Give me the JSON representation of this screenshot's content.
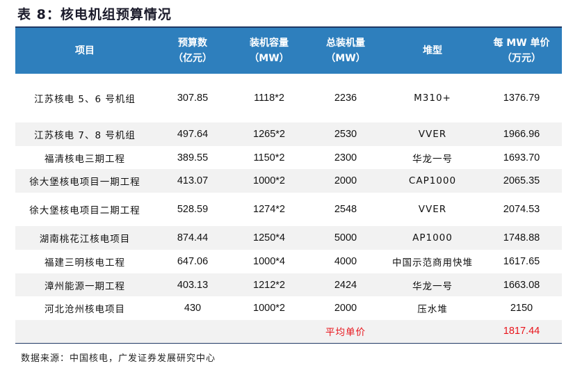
{
  "title": "表 8：核电机组预算情况",
  "header": {
    "project": "项目",
    "budget": [
      "预算数",
      "（亿元）"
    ],
    "capacity": [
      "装机容量",
      "（MW）"
    ],
    "total_capacity": [
      "总装机量",
      "（MW）"
    ],
    "reactor": "堆型",
    "unit_price": [
      "每 MW 单价",
      "（万元）"
    ]
  },
  "rows": [
    {
      "project": "江苏核电 5、6 号机组",
      "budget": "307.85",
      "capacity": "1118*2",
      "total": "2236",
      "reactor": "M310+",
      "price": "1376.79"
    },
    {
      "project": "江苏核电 7、8 号机组",
      "budget": "497.64",
      "capacity": "1265*2",
      "total": "2530",
      "reactor": "VVER",
      "price": "1966.96"
    },
    {
      "project": "福清核电三期工程",
      "budget": "389.55",
      "capacity": "1150*2",
      "total": "2300",
      "reactor": "华龙一号",
      "price": "1693.70"
    },
    {
      "project": "徐大堡核电项目一期工程",
      "budget": "413.07",
      "capacity": "1000*2",
      "total": "2000",
      "reactor": "CAP1000",
      "price": "2065.35"
    },
    {
      "project": "徐大堡核电项目二期工程",
      "budget": "528.59",
      "capacity": "1274*2",
      "total": "2548",
      "reactor": "VVER",
      "price": "2074.53"
    },
    {
      "project": "湖南桃花江核电项目",
      "budget": "874.44",
      "capacity": "1250*4",
      "total": "5000",
      "reactor": "AP1000",
      "price": "1748.88"
    },
    {
      "project": "福建三明核电工程",
      "budget": "647.06",
      "capacity": "1000*4",
      "total": "4000",
      "reactor": "中国示范商用快堆",
      "price": "1617.65"
    },
    {
      "project": "漳州能源一期工程",
      "budget": "403.13",
      "capacity": "1212*2",
      "total": "2424",
      "reactor": "华龙一号",
      "price": "1663.08"
    },
    {
      "project": "河北沧州核电项目",
      "budget": "430",
      "capacity": "1000*2",
      "total": "2000",
      "reactor": "压水堆",
      "price": "2150"
    }
  ],
  "summary": {
    "label": "平均单价",
    "value": "1817.44"
  },
  "source": "数据来源：中国核电，广发证券发展研究中心",
  "colors": {
    "header_bg": "#2e7fbd",
    "highlight": "#e8141b",
    "row_alt": "#f2f2f2"
  }
}
